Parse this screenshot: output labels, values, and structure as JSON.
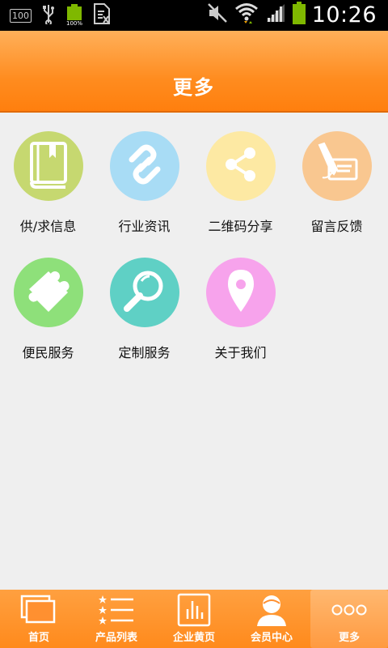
{
  "status_bar": {
    "badge": "100",
    "battery_percent_label": "100%",
    "time": "10:26"
  },
  "header": {
    "title": "更多"
  },
  "tiles": [
    {
      "label": "供/求信息",
      "icon": "book-icon",
      "color": "#c6d870"
    },
    {
      "label": "行业资讯",
      "icon": "link-icon",
      "color": "#a8dcf5"
    },
    {
      "label": "二维码分享",
      "icon": "share-icon",
      "color": "#fde9a3"
    },
    {
      "label": "留言反馈",
      "icon": "pen-icon",
      "color": "#f9c790"
    },
    {
      "label": "便民服务",
      "icon": "puzzle-icon",
      "color": "#8ee07a"
    },
    {
      "label": "定制服务",
      "icon": "search-icon",
      "color": "#5fd0c5"
    },
    {
      "label": "关于我们",
      "icon": "location-pin-icon",
      "color": "#f7a3ec"
    }
  ],
  "bottom_nav": [
    {
      "label": "首页",
      "icon": "home-windows-icon"
    },
    {
      "label": "产品列表",
      "icon": "star-list-icon"
    },
    {
      "label": "企业黄页",
      "icon": "bar-book-icon"
    },
    {
      "label": "会员中心",
      "icon": "user-icon"
    },
    {
      "label": "更多",
      "icon": "more-dots-icon",
      "active": true
    }
  ]
}
